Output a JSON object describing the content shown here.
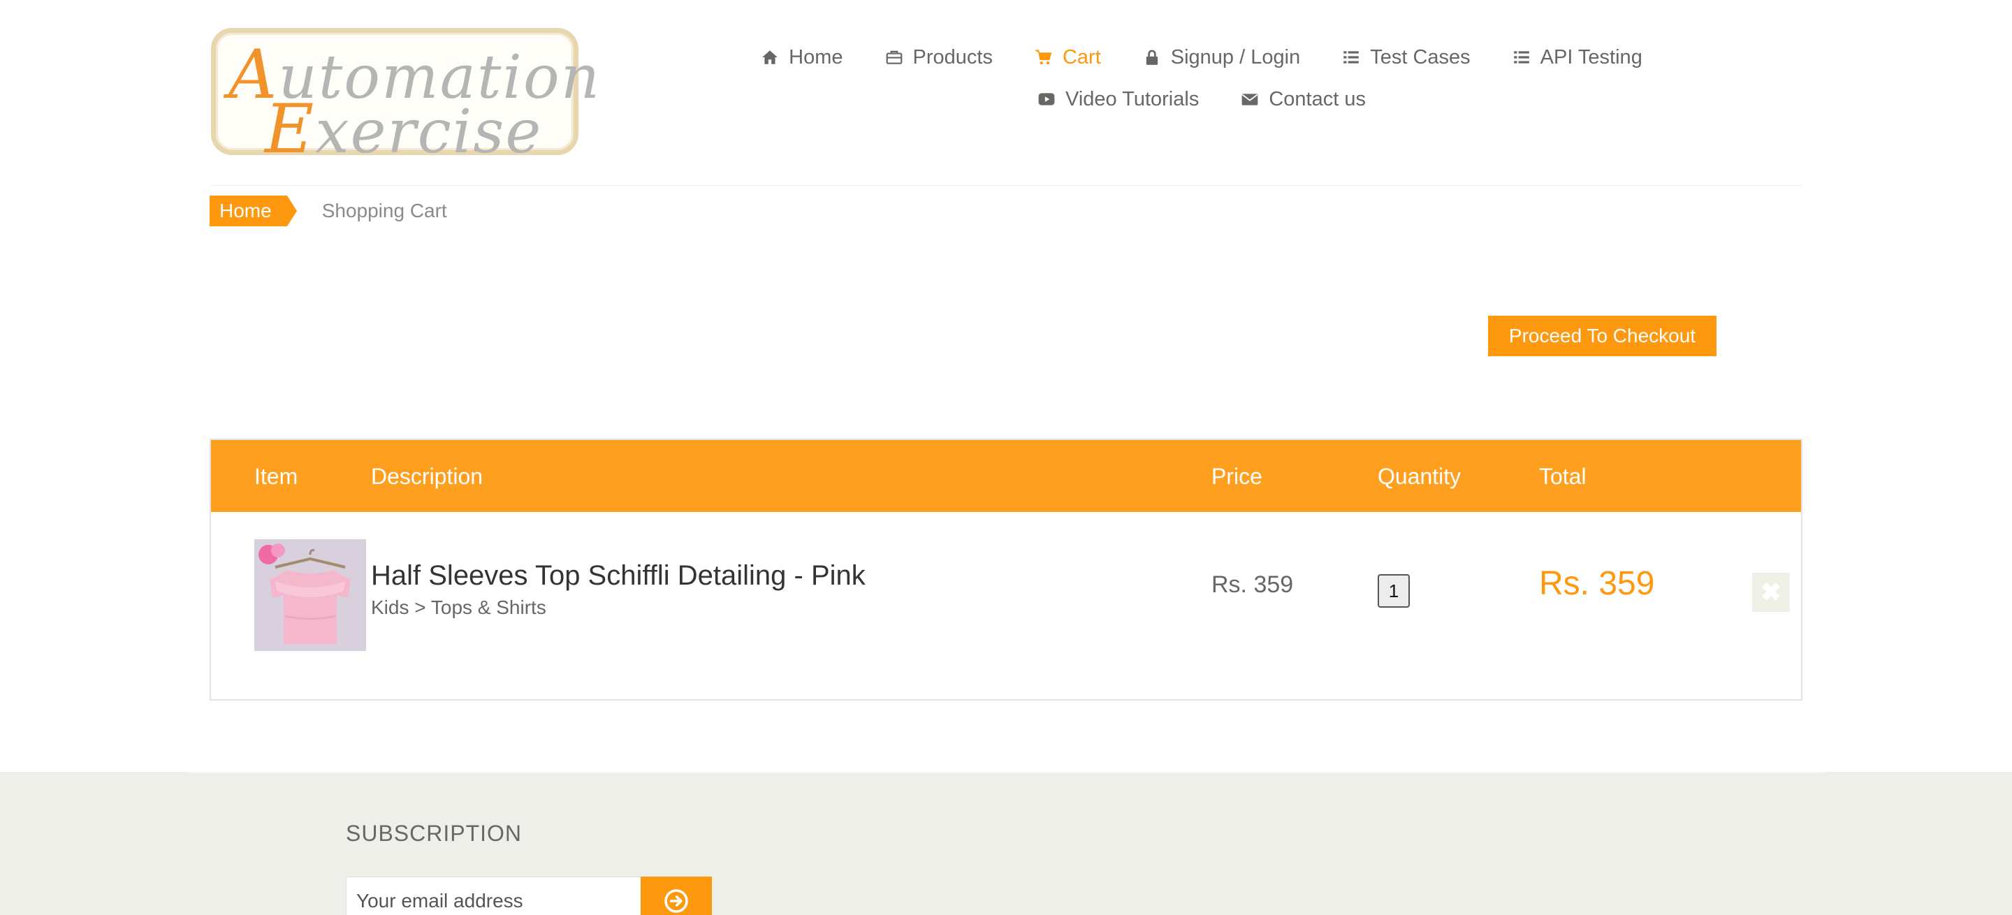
{
  "logo": {
    "line1_cap": "A",
    "line1_rest": "utomation",
    "line2_cap": "E",
    "line2_rest": "xercise"
  },
  "nav": {
    "row1": [
      {
        "label": "Home",
        "icon": "home-icon"
      },
      {
        "label": "Products",
        "icon": "briefcase-icon"
      },
      {
        "label": "Cart",
        "icon": "cart-icon",
        "active": true
      },
      {
        "label": "Signup / Login",
        "icon": "lock-icon"
      },
      {
        "label": "Test Cases",
        "icon": "list-icon"
      },
      {
        "label": "API Testing",
        "icon": "list-icon"
      }
    ],
    "row2": [
      {
        "label": "Video Tutorials",
        "icon": "youtube-play-icon"
      },
      {
        "label": "Contact us",
        "icon": "envelope-icon"
      }
    ]
  },
  "breadcrumb": {
    "home": "Home",
    "current": "Shopping Cart"
  },
  "checkout": {
    "label": "Proceed To Checkout"
  },
  "cart": {
    "headers": {
      "item": "Item",
      "description": "Description",
      "price": "Price",
      "quantity": "Quantity",
      "total": "Total"
    },
    "items": [
      {
        "name": "Half Sleeves Top Schiffli Detailing - Pink",
        "category": "Kids > Tops & Shirts",
        "price": "Rs. 359",
        "quantity": "1",
        "total": "Rs. 359"
      }
    ]
  },
  "footer": {
    "subscription_title": "SUBSCRIPTION",
    "email_placeholder": "Your email address"
  },
  "colors": {
    "accent": "#FE980F",
    "text": "#696763",
    "footer_bg": "#EFEFE9"
  }
}
